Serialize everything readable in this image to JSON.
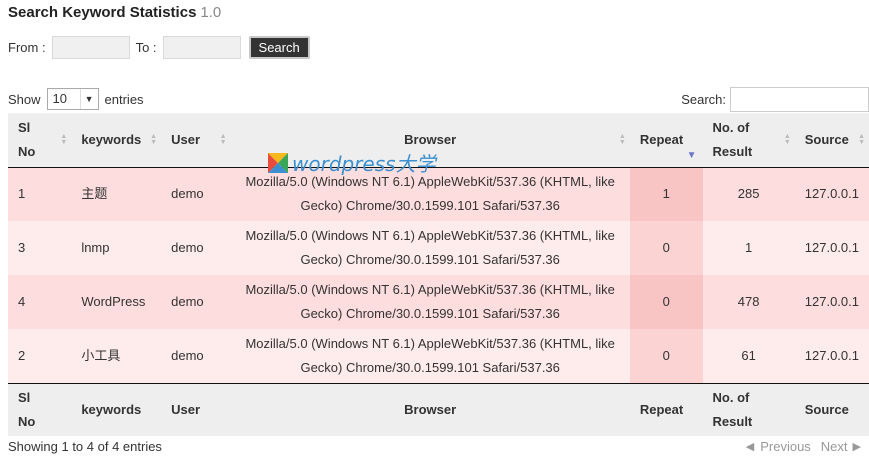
{
  "page": {
    "title": "Search Keyword Statistics",
    "version": "1.0"
  },
  "filter": {
    "from_label": "From :",
    "to_label": "To :",
    "from_value": "",
    "to_value": "",
    "search_button": "Search"
  },
  "length_menu": {
    "show_label": "Show",
    "selected": "10",
    "entries_label": "entries"
  },
  "table_search": {
    "label": "Search:",
    "value": ""
  },
  "table": {
    "headers": {
      "sl_no": "Sl No",
      "keywords": "keywords",
      "user": "User",
      "browser": "Browser",
      "repeat": "Repeat",
      "no_of_result": "No. of Result",
      "source": "Source"
    },
    "rows": [
      {
        "sl": "1",
        "keyword": "主题",
        "user": "demo",
        "browser": "Mozilla/5.0 (Windows NT 6.1) AppleWebKit/537.36 (KHTML, like Gecko) Chrome/30.0.1599.101 Safari/537.36",
        "repeat": "1",
        "results": "285",
        "source": "127.0.0.1"
      },
      {
        "sl": "3",
        "keyword": "lnmp",
        "user": "demo",
        "browser": "Mozilla/5.0 (Windows NT 6.1) AppleWebKit/537.36 (KHTML, like Gecko) Chrome/30.0.1599.101 Safari/537.36",
        "repeat": "0",
        "results": "1",
        "source": "127.0.0.1"
      },
      {
        "sl": "4",
        "keyword": "WordPress",
        "user": "demo",
        "browser": "Mozilla/5.0 (Windows NT 6.1) AppleWebKit/537.36 (KHTML, like Gecko) Chrome/30.0.1599.101 Safari/537.36",
        "repeat": "0",
        "results": "478",
        "source": "127.0.0.1"
      },
      {
        "sl": "2",
        "keyword": "小工具",
        "user": "demo",
        "browser": "Mozilla/5.0 (Windows NT 6.1) AppleWebKit/537.36 (KHTML, like Gecko) Chrome/30.0.1599.101 Safari/537.36",
        "repeat": "0",
        "results": "61",
        "source": "127.0.0.1"
      }
    ]
  },
  "watermark": {
    "text": "wordpress大学",
    "icon": "wordpress-daxue-logo-icon"
  },
  "footer": {
    "info": "Showing 1 to 4 of 4 entries",
    "previous": "Previous",
    "next": "Next"
  },
  "colors": {
    "row_odd": "#fddddd",
    "row_even": "#feebeb",
    "sort_column": "#f9c4c4",
    "button_bg": "#333333",
    "sort_arrow_active": "#6b77c9"
  }
}
